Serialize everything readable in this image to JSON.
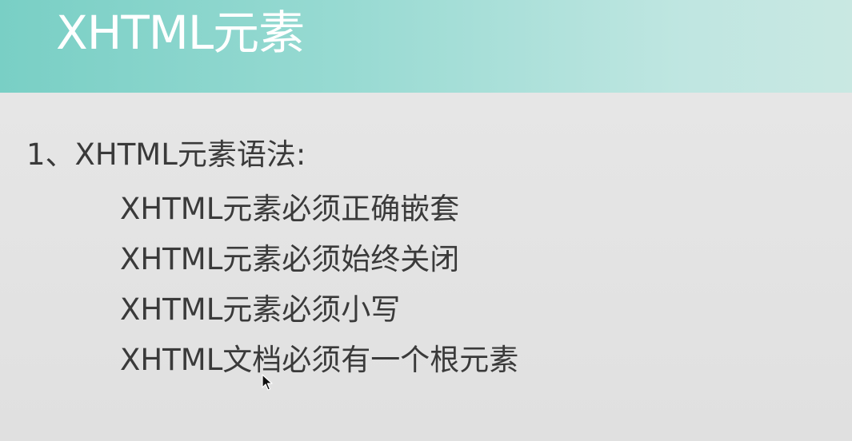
{
  "header": {
    "title": "XHTML元素",
    "accent_gradient": [
      "#79cfc5",
      "#c9e8e2"
    ]
  },
  "content": {
    "heading": "1、XHTML元素语法:",
    "rules": [
      "XHTML元素必须正确嵌套",
      "XHTML元素必须始终关闭",
      "XHTML元素必须小写",
      "XHTML文档必须有一个根元素"
    ]
  },
  "cursor": {
    "icon": "mouse-pointer-icon"
  }
}
